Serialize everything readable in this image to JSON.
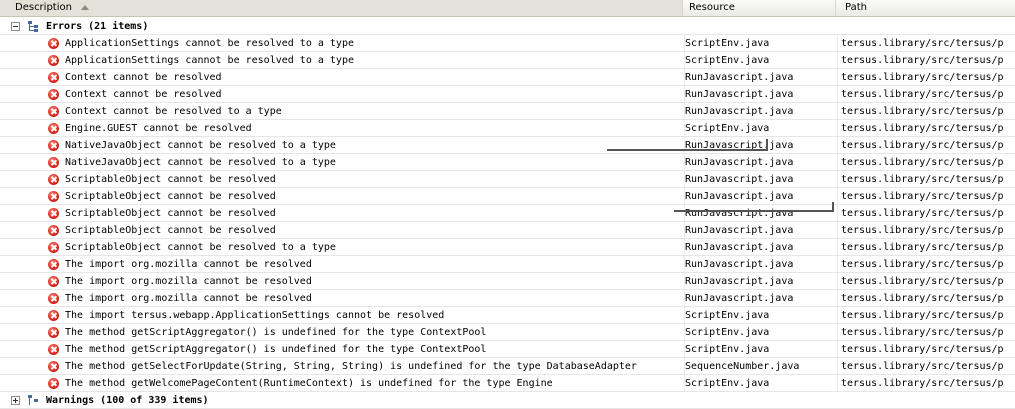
{
  "columns": {
    "description": "Description",
    "resource": "Resource",
    "path": "Path"
  },
  "errors_group": {
    "label": "Errors (21 items)"
  },
  "warnings_group": {
    "label": "Warnings (100 of 339 items)"
  },
  "rows": [
    {
      "desc": "ApplicationSettings cannot be resolved to a type",
      "res": "ScriptEnv.java",
      "path": "tersus.library/src/tersus/p"
    },
    {
      "desc": "ApplicationSettings cannot be resolved to a type",
      "res": "ScriptEnv.java",
      "path": "tersus.library/src/tersus/p"
    },
    {
      "desc": "Context cannot be resolved",
      "res": "RunJavascript.java",
      "path": "tersus.library/src/tersus/p"
    },
    {
      "desc": "Context cannot be resolved",
      "res": "RunJavascript.java",
      "path": "tersus.library/src/tersus/p"
    },
    {
      "desc": "Context cannot be resolved to a type",
      "res": "RunJavascript.java",
      "path": "tersus.library/src/tersus/p"
    },
    {
      "desc": "Engine.GUEST cannot be resolved",
      "res": "ScriptEnv.java",
      "path": "tersus.library/src/tersus/p"
    },
    {
      "desc": "NativeJavaObject cannot be resolved to a type",
      "res": "RunJavascript.java",
      "path": "tersus.library/src/tersus/p"
    },
    {
      "desc": "NativeJavaObject cannot be resolved to a type",
      "res": "RunJavascript.java",
      "path": "tersus.library/src/tersus/p"
    },
    {
      "desc": "ScriptableObject cannot be resolved",
      "res": "RunJavascript.java",
      "path": "tersus.library/src/tersus/p"
    },
    {
      "desc": "ScriptableObject cannot be resolved",
      "res": "RunJavascript.java",
      "path": "tersus.library/src/tersus/p"
    },
    {
      "desc": "ScriptableObject cannot be resolved",
      "res": "RunJavascript.java",
      "path": "tersus.library/src/tersus/p"
    },
    {
      "desc": "ScriptableObject cannot be resolved",
      "res": "RunJavascript.java",
      "path": "tersus.library/src/tersus/p"
    },
    {
      "desc": "ScriptableObject cannot be resolved to a type",
      "res": "RunJavascript.java",
      "path": "tersus.library/src/tersus/p"
    },
    {
      "desc": "The import org.mozilla cannot be resolved",
      "res": "RunJavascript.java",
      "path": "tersus.library/src/tersus/p"
    },
    {
      "desc": "The import org.mozilla cannot be resolved",
      "res": "RunJavascript.java",
      "path": "tersus.library/src/tersus/p"
    },
    {
      "desc": "The import org.mozilla cannot be resolved",
      "res": "RunJavascript.java",
      "path": "tersus.library/src/tersus/p"
    },
    {
      "desc": "The import tersus.webapp.ApplicationSettings cannot be resolved",
      "res": "ScriptEnv.java",
      "path": "tersus.library/src/tersus/p"
    },
    {
      "desc": "The method getScriptAggregator() is undefined for the type ContextPool",
      "res": "ScriptEnv.java",
      "path": "tersus.library/src/tersus/p"
    },
    {
      "desc": "The method getScriptAggregator() is undefined for the type ContextPool",
      "res": "ScriptEnv.java",
      "path": "tersus.library/src/tersus/p"
    },
    {
      "desc": "The method getSelectForUpdate(String, String, String) is undefined for the type DatabaseAdapter",
      "res": "SequenceNumber.java",
      "path": "tersus.library/src/tersus/p"
    },
    {
      "desc": "The method getWelcomePageContent(RuntimeContext) is undefined for the type Engine",
      "res": "ScriptEnv.java",
      "path": "tersus.library/src/tersus/p"
    }
  ]
}
